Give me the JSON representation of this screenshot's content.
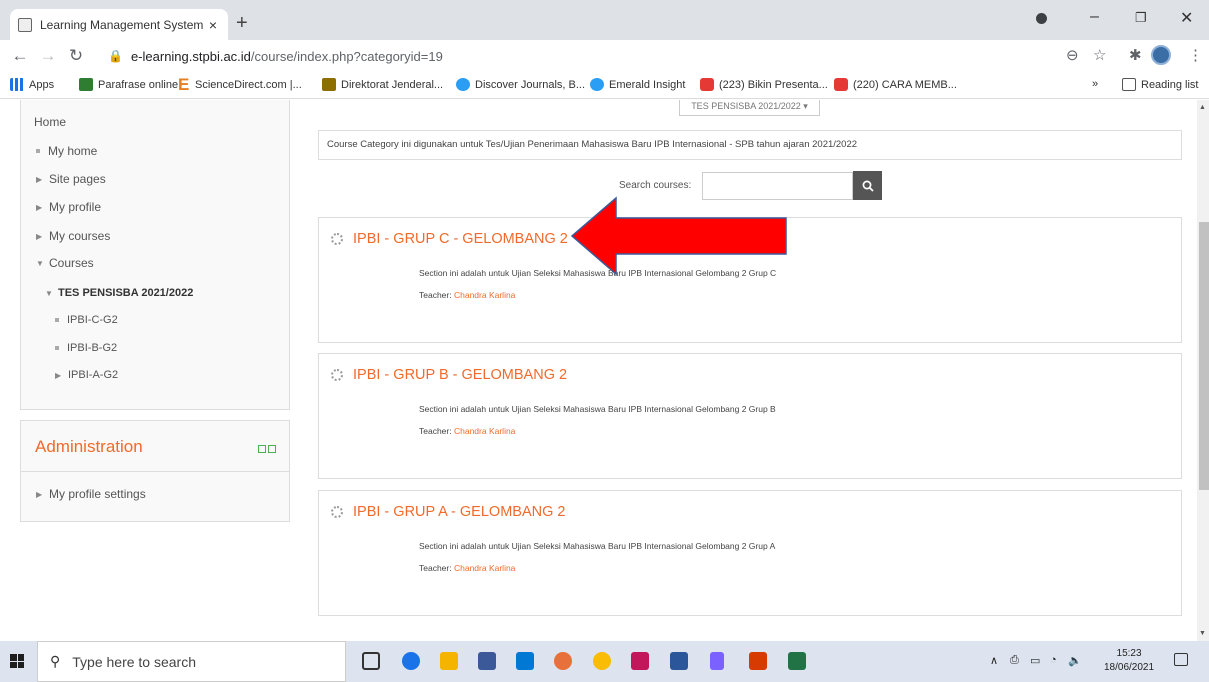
{
  "browser": {
    "tab_title": "Learning Management System ST",
    "tab_close": "×",
    "new_tab": "+",
    "url_domain": "e-learning.stpbi.ac.id",
    "url_path": "/course/index.php?categoryid=19",
    "bookmarks": [
      {
        "label": "Apps",
        "icon": "apps-grid-icon"
      },
      {
        "label": "Parafrase online",
        "icon": "parafrase-icon"
      },
      {
        "label": "ScienceDirect.com |...",
        "icon": "elsevier-icon"
      },
      {
        "label": "Direktorat Jenderal...",
        "icon": "dikti-icon"
      },
      {
        "label": "Discover Journals, B...",
        "icon": "discover-icon"
      },
      {
        "label": "Emerald Insight",
        "icon": "emerald-icon"
      },
      {
        "label": "(223) Bikin Presenta...",
        "icon": "youtube-icon"
      },
      {
        "label": "(220) CARA MEMB...",
        "icon": "youtube-icon"
      }
    ],
    "bookmarks_overflow": "»",
    "reading_list": "Reading list"
  },
  "sidebar": {
    "home": "Home",
    "items": [
      {
        "label": "My home",
        "marker": "bullet"
      },
      {
        "label": "Site pages",
        "marker": "collapsed"
      },
      {
        "label": "My profile",
        "marker": "collapsed"
      },
      {
        "label": "My courses",
        "marker": "collapsed"
      },
      {
        "label": "Courses",
        "marker": "expanded"
      },
      {
        "label": "TES PENSISBA 2021/2022",
        "marker": "expanded"
      },
      {
        "label": "IPBI-C-G2",
        "marker": "bullet"
      },
      {
        "label": "IPBI-B-G2",
        "marker": "bullet"
      },
      {
        "label": "IPBI-A-G2",
        "marker": "collapsed"
      }
    ]
  },
  "admin": {
    "title": "Administration",
    "profile_settings": "My profile settings"
  },
  "main": {
    "category_select": "TES PENSISBA 2021/2022",
    "category_description": "Course Category ini digunakan untuk Tes/Ujian Penerimaan Mahasiswa Baru IPB Internasional - SPB  tahun ajaran 2021/2022",
    "search_label": "Search courses:",
    "search_value": "",
    "courses": [
      {
        "title": "IPBI - GRUP C - GELOMBANG 2",
        "summary": "Section ini adalah untuk Ujian Seleksi Mahasiswa Baru IPB Internasional Gelombang 2 Grup C",
        "teacher_label": "Teacher:",
        "teacher": "Chandra Karlina"
      },
      {
        "title": "IPBI - GRUP B - GELOMBANG 2",
        "summary": "Section ini adalah untuk Ujian Seleksi Mahasiswa Baru IPB Internasional Gelombang 2 Grup B",
        "teacher_label": "Teacher:",
        "teacher": "Chandra Karlina"
      },
      {
        "title": "IPBI - GRUP A - GELOMBANG 2",
        "summary": "Section ini adalah untuk Ujian Seleksi Mahasiswa Baru IPB Internasional Gelombang 2 Grup A",
        "teacher_label": "Teacher:",
        "teacher": "Chandra Karlina"
      }
    ],
    "annotation_arrow_color": "#ff0000"
  },
  "taskbar": {
    "search_placeholder": "Type here to search",
    "time": "15:23",
    "date": "18/06/2021"
  },
  "colors": {
    "accent": "#f06a2b",
    "sidebar_bg": "#f9f9f9",
    "taskbar_bg": "#dde4ef"
  }
}
